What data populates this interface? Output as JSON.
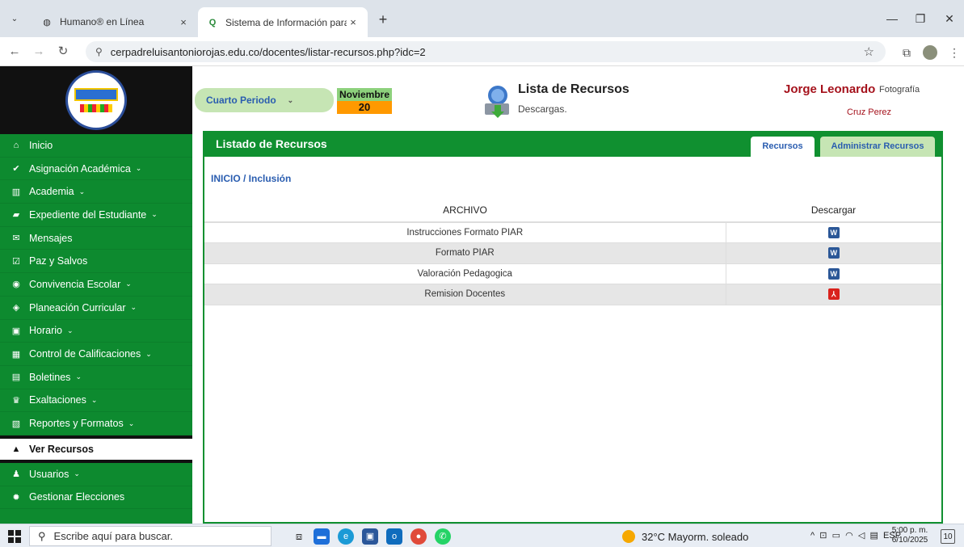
{
  "browser": {
    "tabs": [
      {
        "label": "Humano® en Línea",
        "close": "×"
      },
      {
        "label": "Sistema de Información para C",
        "close": "×"
      }
    ],
    "new_tab": "+",
    "url": "cerpadreluisantoniorojas.edu.co/docentes/listar-recursos.php?idc=2"
  },
  "header": {
    "period": "Cuarto Periodo",
    "month": "Noviembre",
    "day": "20",
    "title": "Lista de Recursos",
    "subtitle": "Descargas.",
    "user_name": "Jorge Leonardo",
    "photo_link": "Fotografía",
    "user_surname": "Cruz Perez"
  },
  "sidebar": {
    "items": [
      {
        "label": "Inicio",
        "icon": "home-icon",
        "glyph": "⌂",
        "chev": false
      },
      {
        "label": "Asignación Académica",
        "icon": "check-icon",
        "glyph": "✔",
        "chev": true
      },
      {
        "label": "Academia",
        "icon": "institution-icon",
        "glyph": "▥",
        "chev": true
      },
      {
        "label": "Expediente del Estudiante",
        "icon": "folder-icon",
        "glyph": "▰",
        "chev": true
      },
      {
        "label": "Mensajes",
        "icon": "envelope-icon",
        "glyph": "✉",
        "chev": false
      },
      {
        "label": "Paz y Salvos",
        "icon": "checkbox-icon",
        "glyph": "☑",
        "chev": false
      },
      {
        "label": "Convivencia Escolar",
        "icon": "eye-icon",
        "glyph": "◉",
        "chev": true
      },
      {
        "label": "Planeación Curricular",
        "icon": "shield-icon",
        "glyph": "◈",
        "chev": true
      },
      {
        "label": "Horario",
        "icon": "calendar-check-icon",
        "glyph": "▣",
        "chev": true
      },
      {
        "label": "Control de Calificaciones",
        "icon": "calendar-icon",
        "glyph": "▦",
        "chev": true
      },
      {
        "label": "Boletines",
        "icon": "file-icon",
        "glyph": "▤",
        "chev": true
      },
      {
        "label": "Exaltaciones",
        "icon": "trophy-icon",
        "glyph": "♛",
        "chev": true
      },
      {
        "label": "Reportes y Formatos",
        "icon": "report-icon",
        "glyph": "▧",
        "chev": true
      }
    ],
    "active": {
      "label": "Ver Recursos",
      "icon": "resources-icon",
      "glyph": "▲"
    },
    "items_after": [
      {
        "label": "Usuarios",
        "icon": "users-icon",
        "glyph": "♟",
        "chev": true
      },
      {
        "label": "Gestionar Elecciones",
        "icon": "gear-icon",
        "glyph": "✹",
        "chev": false
      }
    ]
  },
  "panel": {
    "title": "Listado de Recursos",
    "tab_resources": "Recursos",
    "tab_admin": "Administrar Recursos",
    "breadcrumb": "INICIO / Inclusión",
    "col_file": "ARCHIVO",
    "col_download": "Descargar",
    "rows": [
      {
        "name": "Instrucciones Formato PIAR",
        "type": "word"
      },
      {
        "name": "Formato PIAR",
        "type": "word"
      },
      {
        "name": "Valoración Pedagogica",
        "type": "word"
      },
      {
        "name": "Remision Docentes",
        "type": "pdf"
      }
    ]
  },
  "taskbar": {
    "search_placeholder": "Escribe aquí para buscar.",
    "weather": "32°C Mayorm. soleado",
    "lang": "ESP",
    "time": "5:00 p. m.",
    "date": "6/10/2025",
    "notif_count": "10"
  },
  "colors": {
    "sidebar": "#0d8a2f",
    "panel_header": "#109030",
    "user_name": "#a5121c",
    "link": "#2a5db0"
  }
}
